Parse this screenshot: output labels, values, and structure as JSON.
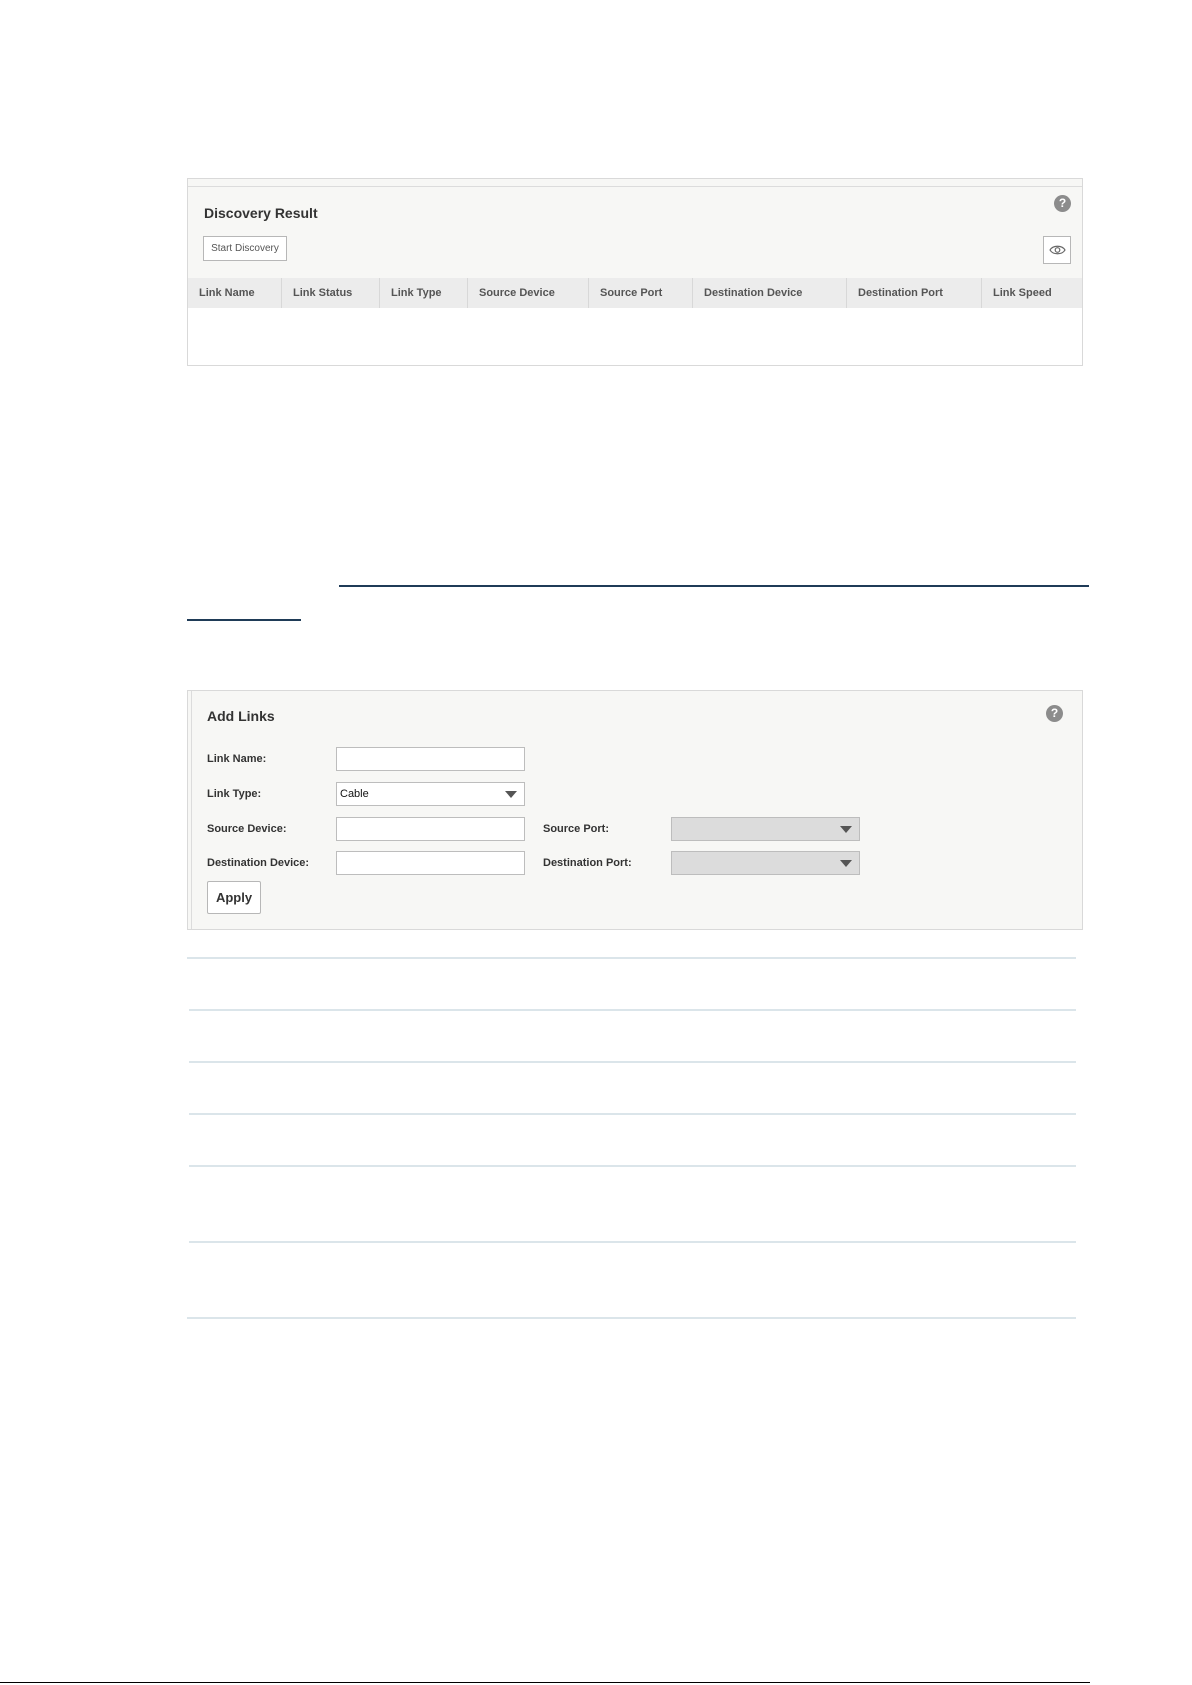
{
  "discovery": {
    "title": "Discovery Result",
    "start_button": "Start Discovery",
    "help": "?",
    "columns": [
      "Link Name",
      "Link Status",
      "Link Type",
      "Source Device",
      "Source Port",
      "Destination Device",
      "Destination Port",
      "Link Speed"
    ],
    "rows": []
  },
  "add_links": {
    "title": "Add Links",
    "help": "?",
    "link_name_label": "Link Name:",
    "link_name_value": "",
    "link_type_label": "Link Type:",
    "link_type_value": "Cable",
    "source_device_label": "Source Device:",
    "source_device_value": "",
    "source_port_label": "Source Port:",
    "source_port_value": "",
    "destination_device_label": "Destination Device:",
    "destination_device_value": "",
    "destination_port_label": "Destination Port:",
    "destination_port_value": "",
    "apply_button": "Apply"
  },
  "icons": {
    "help": "help-icon",
    "eye": "eye-icon",
    "caret": "chevron-down-icon"
  }
}
